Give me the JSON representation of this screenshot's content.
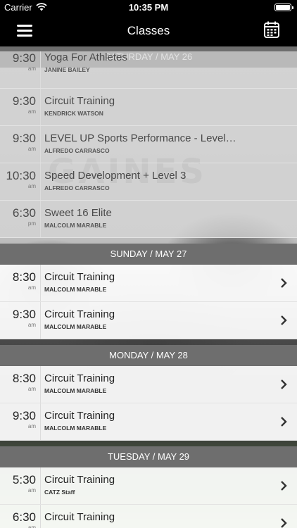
{
  "status_bar": {
    "carrier": "Carrier",
    "time": "10:35 PM"
  },
  "nav": {
    "title": "Classes"
  },
  "sections": [
    {
      "header": "SATURDAY / MAY 26",
      "rows": [
        {
          "time": "9:30",
          "ampm": "am",
          "name": "Yoga For Athletes",
          "instructor": "JANINE BAILEY"
        },
        {
          "time": "9:30",
          "ampm": "am",
          "name": "Circuit Training",
          "instructor": "KENDRICK WATSON"
        },
        {
          "time": "9:30",
          "ampm": "am",
          "name": "LEVEL UP Sports Performance - Level…",
          "instructor": "ALFREDO CARRASCO"
        },
        {
          "time": "10:30",
          "ampm": "am",
          "name": "Speed Development + Level 3",
          "instructor": "ALFREDO CARRASCO"
        },
        {
          "time": "6:30",
          "ampm": "pm",
          "name": "Sweet 16 Elite",
          "instructor": "MALCOLM MARABLE"
        }
      ]
    },
    {
      "header": "SUNDAY / MAY 27",
      "rows": [
        {
          "time": "8:30",
          "ampm": "am",
          "name": "Circuit Training",
          "instructor": "MALCOLM MARABLE"
        },
        {
          "time": "9:30",
          "ampm": "am",
          "name": "Circuit Training",
          "instructor": "MALCOLM MARABLE"
        }
      ]
    },
    {
      "header": "MONDAY / MAY 28",
      "rows": [
        {
          "time": "8:30",
          "ampm": "am",
          "name": "Circuit Training",
          "instructor": "MALCOLM MARABLE"
        },
        {
          "time": "9:30",
          "ampm": "am",
          "name": "Circuit Training",
          "instructor": "MALCOLM MARABLE"
        }
      ]
    },
    {
      "header": "TUESDAY / MAY 29",
      "rows": [
        {
          "time": "5:30",
          "ampm": "am",
          "name": "Circuit Training",
          "instructor": "CATZ Staff"
        },
        {
          "time": "6:30",
          "ampm": "am",
          "name": "Circuit Training",
          "instructor": ""
        }
      ]
    }
  ],
  "icons": {
    "menu": "hamburger-menu-icon",
    "calendar": "calendar-icon",
    "chevron": "chevron-right-icon"
  },
  "colors": {
    "bar": "#000000",
    "section_header": "#6e6e6e"
  }
}
